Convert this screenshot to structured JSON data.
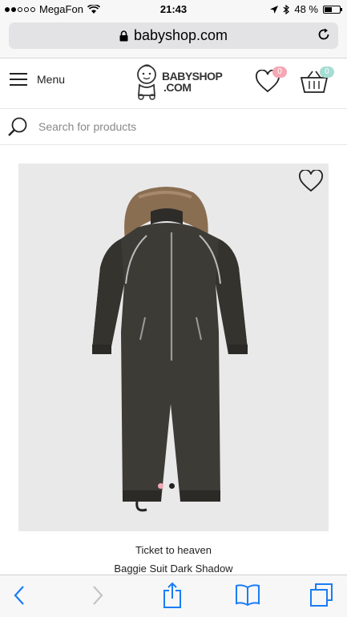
{
  "status": {
    "carrier": "MegaFon",
    "time": "21:43",
    "battery": "48 %",
    "battery_level": 0.48,
    "signal_bars_filled": 2,
    "signal_bars_total": 5
  },
  "browser": {
    "url": "babyshop.com"
  },
  "header": {
    "menu_label": "Menu",
    "logo_line1": "BABYSHOP",
    "logo_line2": ".COM",
    "wishlist_count": "0",
    "cart_count": "0"
  },
  "search": {
    "placeholder": "Search for products"
  },
  "product": {
    "brand": "Ticket to heaven",
    "name": "Baggie Suit Dark Shadow",
    "image_count": 2,
    "active_image": 1
  },
  "colors": {
    "wishlist_badge": "#f4a7b4",
    "cart_badge": "#a6dcd3",
    "garment": "#3d3b36",
    "fur": "#8a6e52",
    "toolbar_icon": "#1a7cf5",
    "pager_active": "#f2a8b4"
  },
  "icons": [
    "lock-icon",
    "reload-icon",
    "hamburger-icon",
    "baby-logo-icon",
    "heart-icon",
    "basket-icon",
    "search-icon",
    "wishlist-heart-icon",
    "back-icon",
    "forward-icon",
    "share-icon",
    "bookmarks-icon",
    "tabs-icon"
  ]
}
